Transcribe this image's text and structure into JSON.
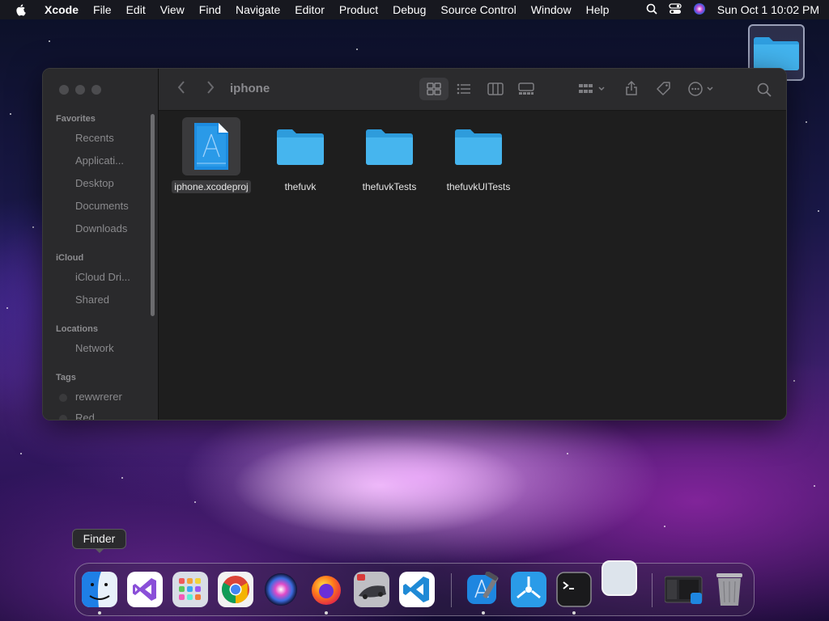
{
  "menubar": {
    "app_name": "Xcode",
    "items": [
      "File",
      "Edit",
      "View",
      "Find",
      "Navigate",
      "Editor",
      "Product",
      "Debug",
      "Source Control",
      "Window",
      "Help"
    ],
    "clock": "Sun Oct 1  10:02 PM"
  },
  "finder": {
    "path_title": "iphone",
    "sidebar": {
      "favorites_header": "Favorites",
      "favorites": [
        "Recents",
        "Applicati...",
        "Desktop",
        "Documents",
        "Downloads"
      ],
      "icloud_header": "iCloud",
      "icloud": [
        "iCloud Dri...",
        "Shared"
      ],
      "locations_header": "Locations",
      "locations": [
        "Network"
      ],
      "tags_header": "Tags",
      "tags": [
        "rewwrerer",
        "Red"
      ]
    },
    "files": [
      {
        "name": "iphone.xcodeproj",
        "kind": "xcodeproj-icon",
        "selected": true
      },
      {
        "name": "thefuvk",
        "kind": "folder-icon",
        "selected": false
      },
      {
        "name": "thefuvkTests",
        "kind": "folder-icon",
        "selected": false
      },
      {
        "name": "thefuvkUITests",
        "kind": "folder-icon",
        "selected": false
      }
    ]
  },
  "dock": {
    "tooltip": "Finder",
    "apps": [
      "finder-icon",
      "visual-studio-icon",
      "launchpad-icon",
      "chrome-icon",
      "siri-icon",
      "firefox-icon",
      "game-icon",
      "vscode-icon",
      "xcode-icon",
      "instruments-icon",
      "terminal-icon",
      "blank-app-icon",
      "window-preview-icon",
      "trash-icon"
    ]
  },
  "colors": {
    "folder_blue": "#34a7e6",
    "xcode_blue": "#1d8ce0",
    "window_bg": "#1e1e1e",
    "sidebar_bg": "#2a2a2c"
  }
}
